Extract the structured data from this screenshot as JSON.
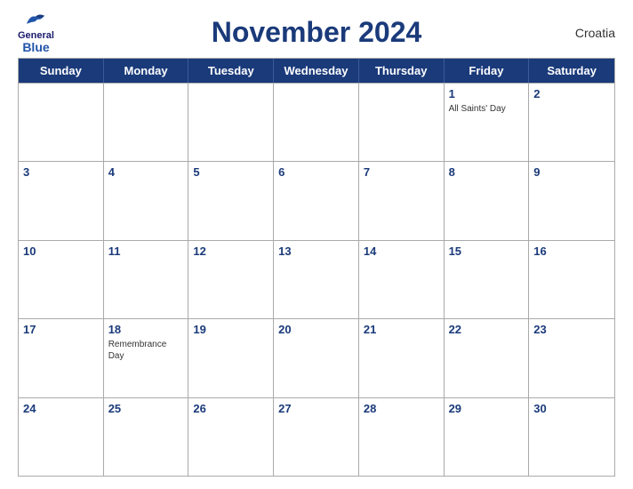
{
  "header": {
    "title": "November 2024",
    "country": "Croatia",
    "logo": {
      "general": "General",
      "blue": "Blue"
    }
  },
  "days_of_week": [
    "Sunday",
    "Monday",
    "Tuesday",
    "Wednesday",
    "Thursday",
    "Friday",
    "Saturday"
  ],
  "weeks": [
    [
      {
        "number": "",
        "event": ""
      },
      {
        "number": "",
        "event": ""
      },
      {
        "number": "",
        "event": ""
      },
      {
        "number": "",
        "event": ""
      },
      {
        "number": "",
        "event": ""
      },
      {
        "number": "1",
        "event": "All Saints' Day"
      },
      {
        "number": "2",
        "event": ""
      }
    ],
    [
      {
        "number": "3",
        "event": ""
      },
      {
        "number": "4",
        "event": ""
      },
      {
        "number": "5",
        "event": ""
      },
      {
        "number": "6",
        "event": ""
      },
      {
        "number": "7",
        "event": ""
      },
      {
        "number": "8",
        "event": ""
      },
      {
        "number": "9",
        "event": ""
      }
    ],
    [
      {
        "number": "10",
        "event": ""
      },
      {
        "number": "11",
        "event": ""
      },
      {
        "number": "12",
        "event": ""
      },
      {
        "number": "13",
        "event": ""
      },
      {
        "number": "14",
        "event": ""
      },
      {
        "number": "15",
        "event": ""
      },
      {
        "number": "16",
        "event": ""
      }
    ],
    [
      {
        "number": "17",
        "event": ""
      },
      {
        "number": "18",
        "event": "Remembrance Day"
      },
      {
        "number": "19",
        "event": ""
      },
      {
        "number": "20",
        "event": ""
      },
      {
        "number": "21",
        "event": ""
      },
      {
        "number": "22",
        "event": ""
      },
      {
        "number": "23",
        "event": ""
      }
    ],
    [
      {
        "number": "24",
        "event": ""
      },
      {
        "number": "25",
        "event": ""
      },
      {
        "number": "26",
        "event": ""
      },
      {
        "number": "27",
        "event": ""
      },
      {
        "number": "28",
        "event": ""
      },
      {
        "number": "29",
        "event": ""
      },
      {
        "number": "30",
        "event": ""
      }
    ]
  ]
}
